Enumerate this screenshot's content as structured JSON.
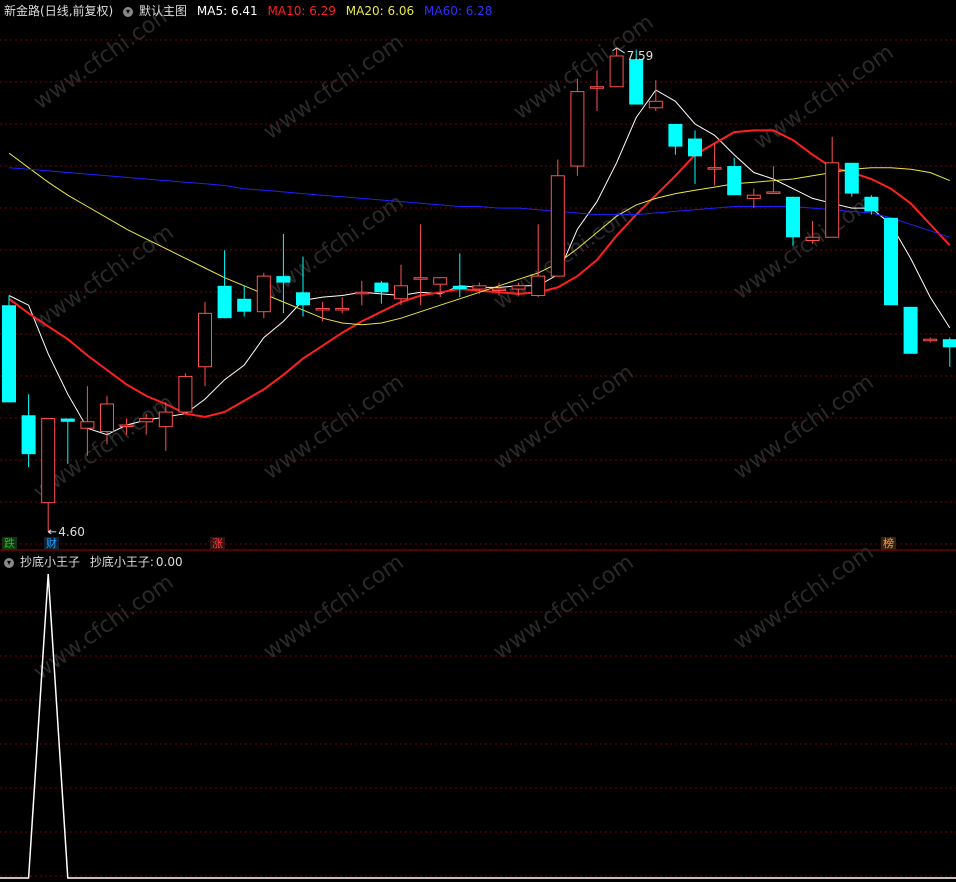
{
  "header": {
    "stock_name": "新金路",
    "period": "(日线,前复权)",
    "main_label": "默认主图",
    "ma5_label": "MA5:",
    "ma5_value": "6.41",
    "ma10_label": "MA10:",
    "ma10_value": "6.29",
    "ma20_label": "MA20:",
    "ma20_value": "6.06",
    "ma60_label": "MA60:",
    "ma60_value": "6.28"
  },
  "colors": {
    "up": "#ff5050",
    "down": "#00ffff",
    "ma5": "#ffffff",
    "ma10": "#ff2020",
    "ma20": "#e8e840",
    "ma60": "#2020ff",
    "grid": "#7a0000",
    "indicator": "#ffffff"
  },
  "annotations": {
    "high_label": "7.59",
    "low_label": "4.60"
  },
  "event_tags": [
    {
      "text": "跌",
      "color": "#20c020"
    },
    {
      "text": "财",
      "color": "#20a0ff"
    },
    {
      "text": "涨",
      "color": "#ff4040"
    },
    {
      "text": "榜",
      "color": "#ffa040"
    }
  ],
  "indicator": {
    "title": "抄底小王子",
    "value_label": "抄底小王子:",
    "value": "0.00"
  },
  "watermark": "www.cfchi.com",
  "chart_data": [
    {
      "type": "candlestick",
      "ylim": [
        4.5,
        7.75
      ],
      "candles": [
        {
          "o": 6.0,
          "h": 6.06,
          "l": 5.4,
          "c": 5.4
        },
        {
          "o": 5.32,
          "h": 5.45,
          "l": 5.0,
          "c": 5.08
        },
        {
          "o": 4.78,
          "h": 5.3,
          "l": 4.6,
          "c": 5.3
        },
        {
          "o": 5.3,
          "h": 5.3,
          "l": 5.02,
          "c": 5.28
        },
        {
          "o": 5.24,
          "h": 5.5,
          "l": 5.07,
          "c": 5.28
        },
        {
          "o": 5.22,
          "h": 5.44,
          "l": 5.14,
          "c": 5.39
        },
        {
          "o": 5.26,
          "h": 5.3,
          "l": 5.2,
          "c": 5.26
        },
        {
          "o": 5.28,
          "h": 5.33,
          "l": 5.2,
          "c": 5.3
        },
        {
          "o": 5.25,
          "h": 5.4,
          "l": 5.1,
          "c": 5.34
        },
        {
          "o": 5.34,
          "h": 5.58,
          "l": 5.34,
          "c": 5.56
        },
        {
          "o": 5.62,
          "h": 6.02,
          "l": 5.5,
          "c": 5.95
        },
        {
          "o": 6.12,
          "h": 6.34,
          "l": 5.92,
          "c": 5.92
        },
        {
          "o": 6.04,
          "h": 6.12,
          "l": 5.93,
          "c": 5.96
        },
        {
          "o": 5.96,
          "h": 6.2,
          "l": 5.92,
          "c": 6.18
        },
        {
          "o": 6.18,
          "h": 6.44,
          "l": 5.95,
          "c": 6.14
        },
        {
          "o": 6.08,
          "h": 6.3,
          "l": 5.93,
          "c": 6.0
        },
        {
          "o": 5.98,
          "h": 6.02,
          "l": 5.9,
          "c": 5.98
        },
        {
          "o": 5.98,
          "h": 6.05,
          "l": 5.95,
          "c": 5.98
        },
        {
          "o": 6.08,
          "h": 6.15,
          "l": 6.0,
          "c": 6.08
        },
        {
          "o": 6.14,
          "h": 6.15,
          "l": 6.01,
          "c": 6.08
        },
        {
          "o": 6.04,
          "h": 6.25,
          "l": 6.0,
          "c": 6.12
        },
        {
          "o": 6.17,
          "h": 6.5,
          "l": 6.0,
          "c": 6.17
        },
        {
          "o": 6.13,
          "h": 6.17,
          "l": 6.05,
          "c": 6.17
        },
        {
          "o": 6.12,
          "h": 6.32,
          "l": 6.05,
          "c": 6.1
        },
        {
          "o": 6.1,
          "h": 6.14,
          "l": 6.07,
          "c": 6.12
        },
        {
          "o": 6.1,
          "h": 6.14,
          "l": 6.06,
          "c": 6.1
        },
        {
          "o": 6.1,
          "h": 6.14,
          "l": 6.06,
          "c": 6.12
        },
        {
          "o": 6.06,
          "h": 6.5,
          "l": 6.05,
          "c": 6.18
        },
        {
          "o": 6.18,
          "h": 6.9,
          "l": 6.18,
          "c": 6.8
        },
        {
          "o": 6.86,
          "h": 7.4,
          "l": 6.8,
          "c": 7.32
        },
        {
          "o": 7.35,
          "h": 7.45,
          "l": 7.2,
          "c": 7.35
        },
        {
          "o": 7.35,
          "h": 7.59,
          "l": 7.35,
          "c": 7.54
        },
        {
          "o": 7.52,
          "h": 7.58,
          "l": 7.24,
          "c": 7.24
        },
        {
          "o": 7.22,
          "h": 7.39,
          "l": 7.2,
          "c": 7.26
        },
        {
          "o": 7.12,
          "h": 7.12,
          "l": 6.93,
          "c": 6.98
        },
        {
          "o": 7.03,
          "h": 7.08,
          "l": 6.75,
          "c": 6.92
        },
        {
          "o": 6.85,
          "h": 7.0,
          "l": 6.74,
          "c": 6.85
        },
        {
          "o": 6.86,
          "h": 6.91,
          "l": 6.68,
          "c": 6.68
        },
        {
          "o": 6.66,
          "h": 6.72,
          "l": 6.6,
          "c": 6.68
        },
        {
          "o": 6.7,
          "h": 6.86,
          "l": 6.7,
          "c": 6.7
        },
        {
          "o": 6.67,
          "h": 6.67,
          "l": 6.37,
          "c": 6.42
        },
        {
          "o": 6.4,
          "h": 6.52,
          "l": 6.38,
          "c": 6.42
        },
        {
          "o": 6.42,
          "h": 7.04,
          "l": 6.42,
          "c": 6.88
        },
        {
          "o": 6.88,
          "h": 6.88,
          "l": 6.67,
          "c": 6.69
        },
        {
          "o": 6.67,
          "h": 6.68,
          "l": 6.56,
          "c": 6.58
        },
        {
          "o": 6.54,
          "h": 6.54,
          "l": 6.0,
          "c": 6.0
        },
        {
          "o": 5.99,
          "h": 5.99,
          "l": 5.7,
          "c": 5.7
        },
        {
          "o": 5.79,
          "h": 5.8,
          "l": 5.77,
          "c": 5.79
        },
        {
          "o": 5.79,
          "h": 5.8,
          "l": 5.62,
          "c": 5.74
        }
      ],
      "ma_lines": [
        {
          "name": "MA5",
          "values": [
            6.06,
            6.0,
            5.7,
            5.45,
            5.24,
            5.2,
            5.26,
            5.29,
            5.31,
            5.33,
            5.42,
            5.54,
            5.63,
            5.8,
            5.9,
            6.03,
            6.05,
            6.06,
            6.08,
            6.07,
            6.06,
            6.08,
            6.07,
            6.12,
            6.11,
            6.11,
            6.12,
            6.12,
            6.19,
            6.47,
            6.64,
            6.88,
            7.16,
            7.33,
            7.26,
            7.12,
            7.05,
            6.93,
            6.82,
            6.78,
            6.72,
            6.66,
            6.63,
            6.6,
            6.6,
            6.5,
            6.29,
            6.05,
            5.86
          ]
        },
        {
          "name": "MA10",
          "values": [
            6.04,
            5.95,
            5.87,
            5.79,
            5.69,
            5.6,
            5.51,
            5.44,
            5.39,
            5.33,
            5.31,
            5.34,
            5.41,
            5.48,
            5.57,
            5.67,
            5.75,
            5.83,
            5.9,
            5.96,
            6.02,
            6.06,
            6.08,
            6.1,
            6.09,
            6.08,
            6.07,
            6.08,
            6.11,
            6.18,
            6.28,
            6.43,
            6.56,
            6.68,
            6.8,
            6.93,
            7.0,
            7.07,
            7.08,
            7.08,
            7.02,
            6.93,
            6.85,
            6.82,
            6.78,
            6.72,
            6.63,
            6.5,
            6.37
          ]
        },
        {
          "name": "MA20",
          "values": [
            6.94,
            6.85,
            6.76,
            6.68,
            6.61,
            6.54,
            6.47,
            6.41,
            6.35,
            6.29,
            6.23,
            6.17,
            6.12,
            6.07,
            6.02,
            5.97,
            5.92,
            5.89,
            5.88,
            5.89,
            5.92,
            5.96,
            6.0,
            6.04,
            6.08,
            6.12,
            6.16,
            6.2,
            6.26,
            6.35,
            6.45,
            6.55,
            6.62,
            6.66,
            6.69,
            6.71,
            6.73,
            6.75,
            6.76,
            6.77,
            6.78,
            6.8,
            6.82,
            6.84,
            6.85,
            6.85,
            6.84,
            6.82,
            6.77
          ]
        },
        {
          "name": "MA60",
          "values": [
            6.85,
            6.84,
            6.83,
            6.82,
            6.81,
            6.8,
            6.79,
            6.78,
            6.77,
            6.76,
            6.75,
            6.74,
            6.72,
            6.71,
            6.7,
            6.69,
            6.68,
            6.67,
            6.66,
            6.65,
            6.64,
            6.63,
            6.62,
            6.61,
            6.61,
            6.6,
            6.6,
            6.59,
            6.58,
            6.57,
            6.56,
            6.56,
            6.56,
            6.57,
            6.58,
            6.59,
            6.6,
            6.61,
            6.61,
            6.61,
            6.61,
            6.6,
            6.59,
            6.58,
            6.57,
            6.54,
            6.5,
            6.46,
            6.42
          ]
        }
      ]
    },
    {
      "type": "line",
      "series": [
        {
          "name": "抄底小王子",
          "values": [
            0,
            0,
            1,
            0,
            0,
            0,
            0,
            0,
            0,
            0,
            0,
            0,
            0,
            0,
            0,
            0,
            0,
            0,
            0,
            0,
            0,
            0,
            0,
            0,
            0,
            0,
            0,
            0,
            0,
            0,
            0,
            0,
            0,
            0,
            0,
            0,
            0,
            0,
            0,
            0,
            0,
            0,
            0,
            0,
            0,
            0,
            0,
            0,
            0
          ]
        }
      ],
      "ylim": [
        0,
        1
      ]
    }
  ]
}
